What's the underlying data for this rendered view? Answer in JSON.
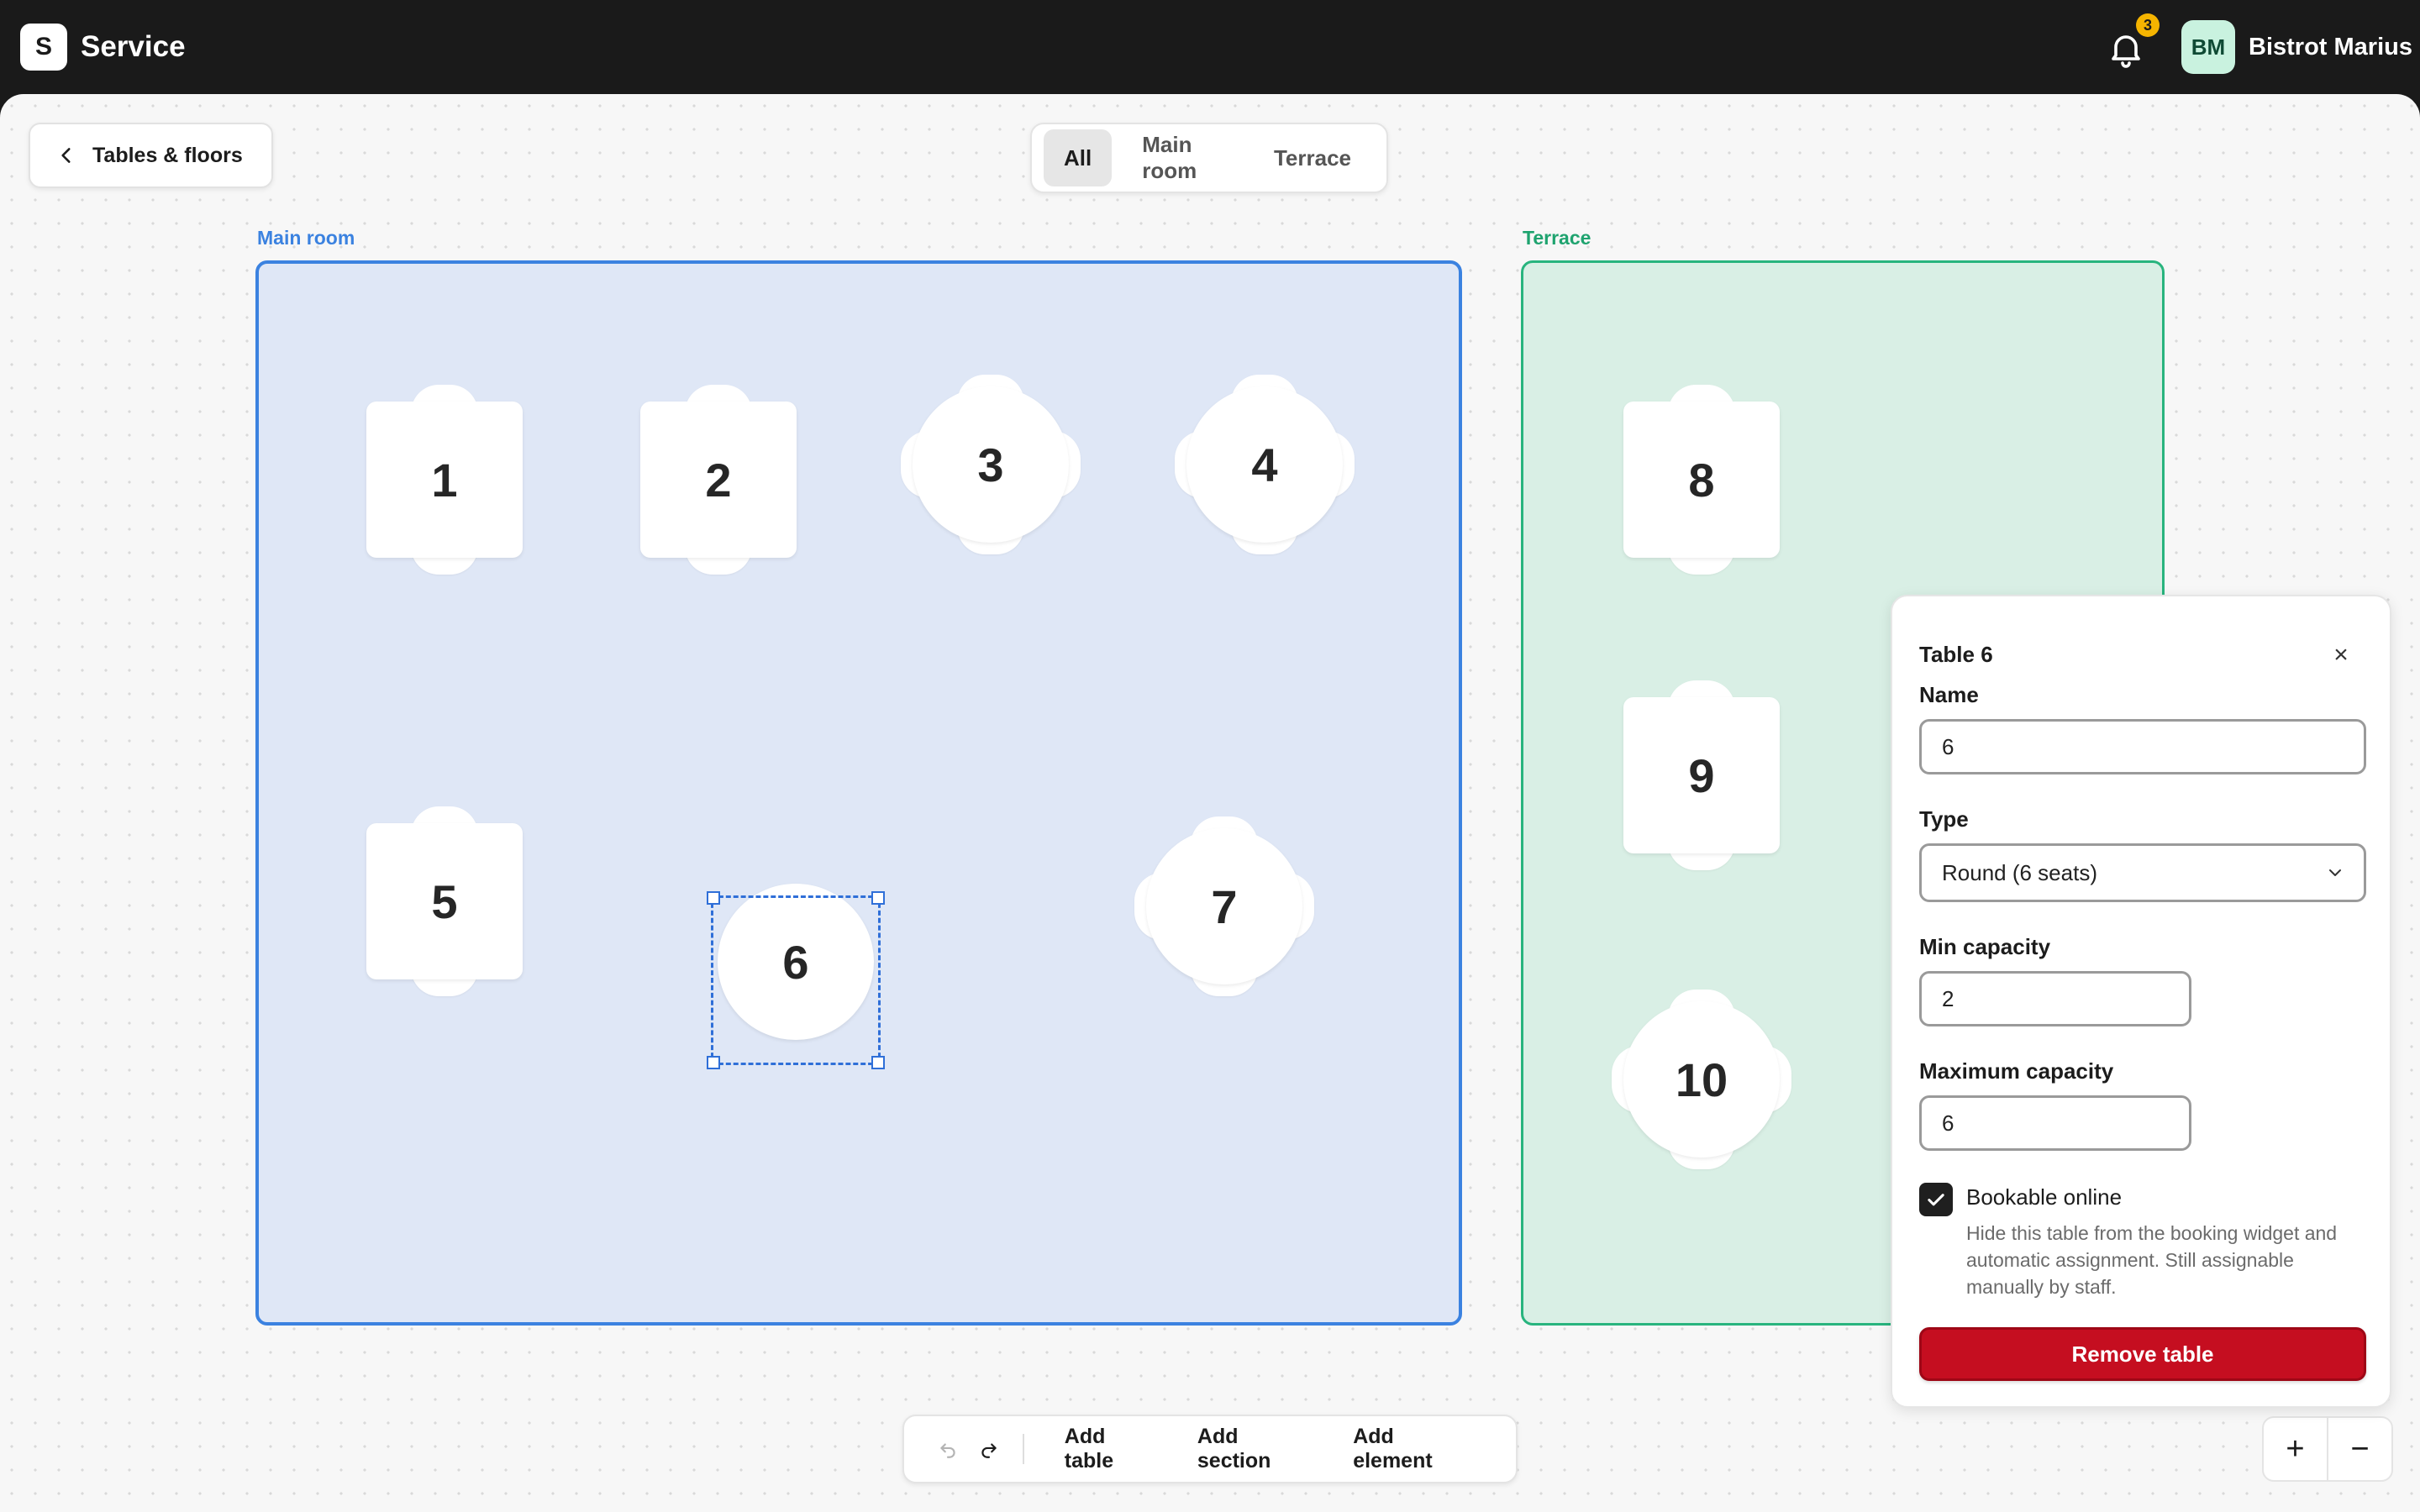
{
  "app": {
    "logo_letter": "S",
    "title": "Service"
  },
  "header": {
    "notification_count": "3",
    "avatar_initials": "BM",
    "restaurant_name": "Bistrot Marius"
  },
  "back_button": {
    "label": "Tables & floors"
  },
  "floor_tabs": [
    {
      "label": "All",
      "active": true
    },
    {
      "label": "Main room",
      "active": false
    },
    {
      "label": "Terrace",
      "active": false
    }
  ],
  "sections": {
    "main": {
      "label": "Main room",
      "color": "#3b82e0"
    },
    "terrace": {
      "label": "Terrace",
      "color": "#28b47e"
    }
  },
  "tables": [
    {
      "name": "1",
      "shape": "square",
      "seats": 2,
      "section": "main"
    },
    {
      "name": "2",
      "shape": "square",
      "seats": 2,
      "section": "main"
    },
    {
      "name": "3",
      "shape": "round",
      "seats": 4,
      "section": "main"
    },
    {
      "name": "4",
      "shape": "round",
      "seats": 4,
      "section": "main"
    },
    {
      "name": "5",
      "shape": "square",
      "seats": 2,
      "section": "main"
    },
    {
      "name": "6",
      "shape": "round",
      "seats": 6,
      "section": "main",
      "selected": true
    },
    {
      "name": "7",
      "shape": "round",
      "seats": 4,
      "section": "main"
    },
    {
      "name": "8",
      "shape": "square",
      "seats": 2,
      "section": "terrace"
    },
    {
      "name": "9",
      "shape": "square",
      "seats": 2,
      "section": "terrace"
    },
    {
      "name": "10",
      "shape": "round",
      "seats": 4,
      "section": "terrace"
    }
  ],
  "toolbar": {
    "undo_icon": "undo-icon",
    "redo_icon": "redo-icon",
    "add_table": "Add table",
    "add_section": "Add section",
    "add_element": "Add element"
  },
  "zoom": {
    "zoom_in": "+",
    "zoom_out": "−"
  },
  "panel": {
    "title": "Table 6",
    "close": "×",
    "name_label": "Name",
    "name_value": "6",
    "type_label": "Type",
    "type_value": "Round (6 seats)",
    "min_label": "Min capacity",
    "min_value": "2",
    "max_label": "Maximum capacity",
    "max_value": "6",
    "bookable_label": "Bookable online",
    "bookable_checked": true,
    "bookable_help": "Hide this table from the booking widget and automatic assignment. Still assignable manually by staff.",
    "remove_label": "Remove table"
  },
  "colors": {
    "accent_blue": "#3b82e0",
    "accent_green": "#28b47e",
    "danger": "#c50e20"
  }
}
